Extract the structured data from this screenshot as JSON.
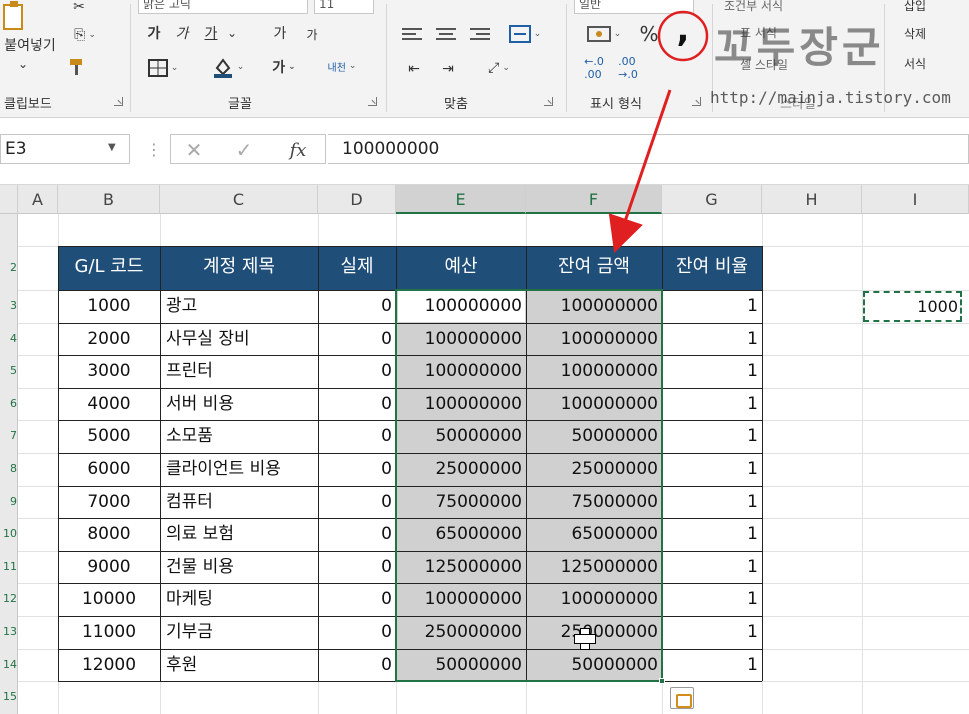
{
  "ribbon": {
    "clipboard": {
      "paste_label": "붙여넣기",
      "group_label": "클립보드"
    },
    "font": {
      "font_name": "맑은 고딕",
      "font_size": "11",
      "bold_label": "가",
      "italic_label": "가",
      "underline_label": "가",
      "grow_label": "가",
      "shrink_label": "가",
      "bold2_label": "가",
      "phonetic_label": "내천",
      "group_label": "글꼴"
    },
    "alignment": {
      "group_label": "맞춤"
    },
    "number": {
      "format_value": "일반",
      "percent_label": "%",
      "comma_label": ",",
      "group_label": "표시 형식"
    },
    "styles": {
      "cond_format_label": "조건부 서식",
      "table_format_label": "표 서식",
      "cell_style_label": "셀 스타일",
      "group_label": "스타일"
    },
    "cells": {
      "insert_label": "삽입",
      "delete_label": "삭제",
      "format_label": "서식"
    }
  },
  "formula_bar": {
    "name_box": "E3",
    "fx_label": "fx",
    "value": "100000000"
  },
  "columns": [
    "A",
    "B",
    "C",
    "D",
    "E",
    "F",
    "G",
    "H",
    "I"
  ],
  "row_numbers": [
    "2",
    "3",
    "4",
    "5",
    "6",
    "7",
    "8",
    "9",
    "10",
    "11",
    "12",
    "13",
    "14",
    "15"
  ],
  "table": {
    "headers": [
      "G/L 코드",
      "계정 제목",
      "실제",
      "예산",
      "잔여 금액",
      "잔여 비율"
    ],
    "rows": [
      [
        "1000",
        "광고",
        "0",
        "100000000",
        "100000000",
        "1"
      ],
      [
        "2000",
        "사무실 장비",
        "0",
        "100000000",
        "100000000",
        "1"
      ],
      [
        "3000",
        "프린터",
        "0",
        "100000000",
        "100000000",
        "1"
      ],
      [
        "4000",
        "서버 비용",
        "0",
        "100000000",
        "100000000",
        "1"
      ],
      [
        "5000",
        "소모품",
        "0",
        "50000000",
        "50000000",
        "1"
      ],
      [
        "6000",
        "클라이언트 비용",
        "0",
        "25000000",
        "25000000",
        "1"
      ],
      [
        "7000",
        "컴퓨터",
        "0",
        "75000000",
        "75000000",
        "1"
      ],
      [
        "8000",
        "의료 보험",
        "0",
        "65000000",
        "65000000",
        "1"
      ],
      [
        "9000",
        "건물 비용",
        "0",
        "125000000",
        "125000000",
        "1"
      ],
      [
        "10000",
        "마케팅",
        "0",
        "100000000",
        "100000000",
        "1"
      ],
      [
        "11000",
        "기부금",
        "0",
        "250000000",
        "250000000",
        "1"
      ],
      [
        "12000",
        "후원",
        "0",
        "50000000",
        "50000000",
        "1"
      ]
    ]
  },
  "copied_cell": {
    "value": "1000"
  },
  "watermark": {
    "title": "꼬두장군",
    "url": "http://mainja.tistory.com"
  },
  "colors": {
    "header_fill": "#1f4e79",
    "selection_green": "#217346",
    "annotation_red": "#e02020"
  }
}
